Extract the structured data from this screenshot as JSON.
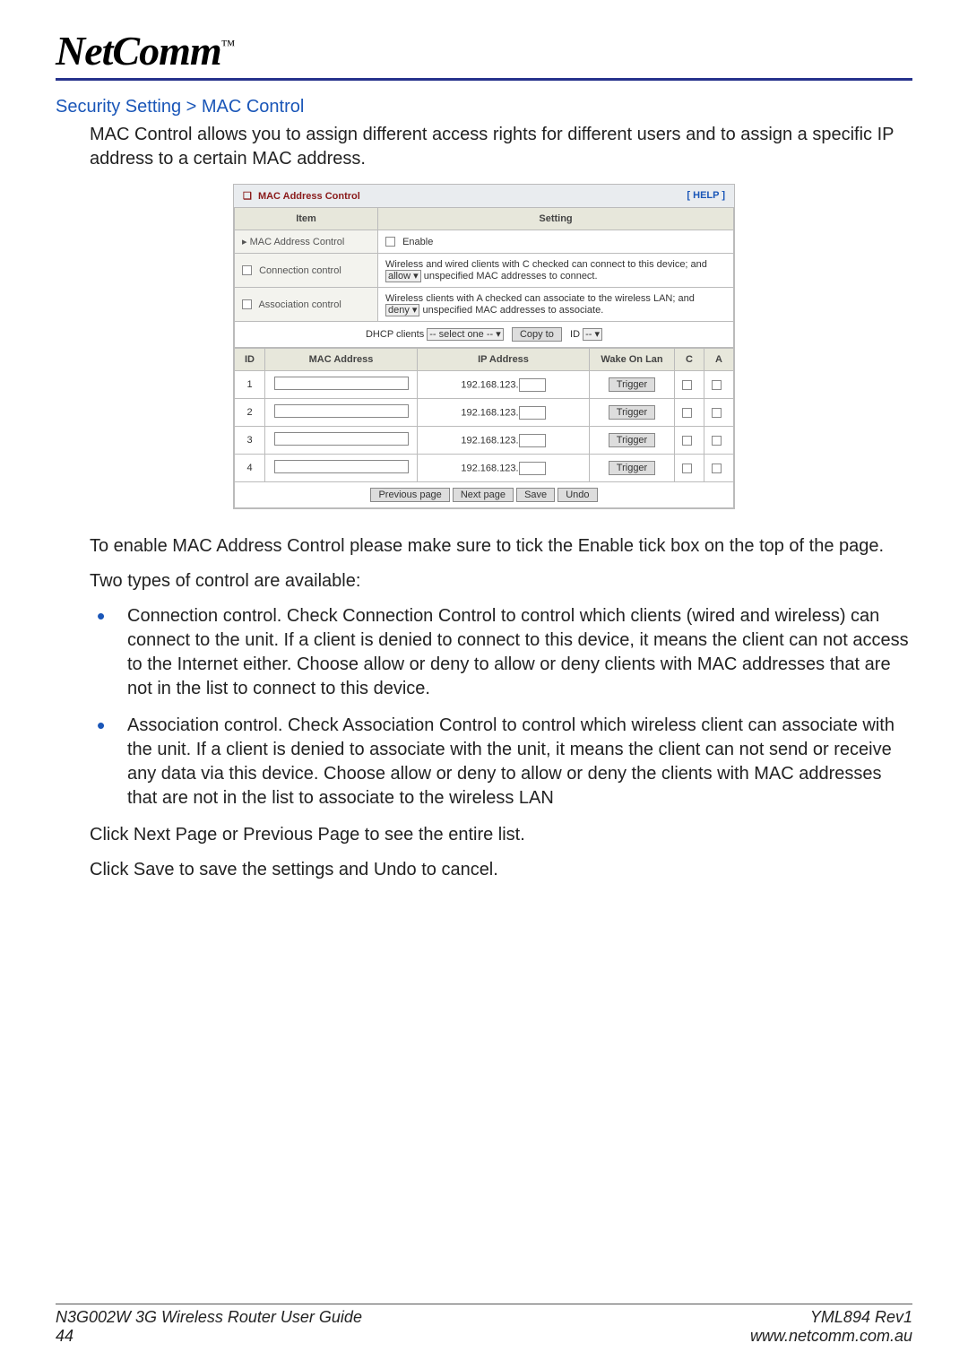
{
  "logo": {
    "text": "NetComm",
    "tm": "™"
  },
  "breadcrumb": "Security Setting > MAC Control",
  "intro": "MAC Control allows you to assign different access rights for different users and to assign a specific IP address to a certain MAC address.",
  "panel": {
    "title": "MAC Address Control",
    "help": "[ HELP ]",
    "col_item": "Item",
    "col_setting": "Setting",
    "rows": {
      "mac_ctrl_label": "▸ MAC Address Control",
      "mac_ctrl_enable": "Enable",
      "conn_ctrl_label": "Connection control",
      "conn_ctrl_text1": "Wireless and wired clients with C checked can connect to this device; and",
      "conn_ctrl_select": "allow",
      "conn_ctrl_text2": "unspecified MAC addresses to connect.",
      "assoc_ctrl_label": "Association control",
      "assoc_ctrl_text1": "Wireless clients with A checked can associate to the wireless LAN; and",
      "assoc_ctrl_select": "deny",
      "assoc_ctrl_text2": "unspecified MAC addresses to associate.",
      "dhcp_label": "DHCP clients",
      "dhcp_select": "-- select one --",
      "dhcp_copy": "Copy to",
      "dhcp_id_label": "ID",
      "dhcp_id_select": "--"
    },
    "table": {
      "headers": {
        "id": "ID",
        "mac": "MAC Address",
        "ip": "IP Address",
        "wol": "Wake On Lan",
        "c": "C",
        "a": "A"
      },
      "ip_prefix": "192.168.123.",
      "trigger": "Trigger",
      "rows": [
        {
          "id": "1"
        },
        {
          "id": "2"
        },
        {
          "id": "3"
        },
        {
          "id": "4"
        }
      ]
    },
    "buttons": {
      "prev": "Previous page",
      "next": "Next page",
      "save": "Save",
      "undo": "Undo"
    }
  },
  "para_enable": "To enable MAC Address Control please make sure to tick the Enable tick box on the top of the page.",
  "para_types": "Two types of control are available:",
  "bullets": [
    "Connection control. Check Connection Control to control which clients (wired and wireless) can connect to the unit. If a client is denied to connect to this device, it means the client can not access to the Internet either. Choose allow or deny to allow or deny clients with MAC addresses that are not in the list to connect to this device.",
    "Association control. Check Association Control to control which wireless client can associate with the unit. If a client is denied to associate with the unit, it means the client can not send or receive any data via this device. Choose allow or deny to allow or deny the clients with MAC addresses that are not in the list to associate to the wireless LAN"
  ],
  "para_nextprev": "Click Next Page or Previous Page to see the entire list.",
  "para_save": "Click Save to save the settings and Undo to cancel.",
  "footer": {
    "left1": "N3G002W 3G Wireless Router User Guide",
    "left2": "44",
    "right1": "YML894 Rev1",
    "right2": "www.netcomm.com.au"
  }
}
